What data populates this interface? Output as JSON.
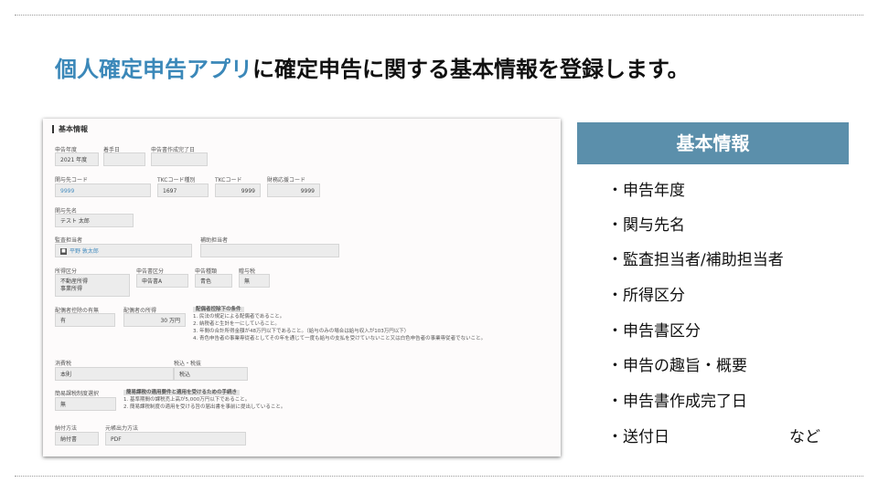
{
  "headline": {
    "accent": "個人確定申告アプリ",
    "rest": "に確定申告に関する基本情報を登録します。"
  },
  "shot": {
    "section_title": "基本情報",
    "fields": {
      "year_label": "申告年度",
      "year_value": "2021 年度",
      "start_label": "着手日",
      "start_value": "",
      "done_label": "申告書作成完了日",
      "done_value": "",
      "client_code_label": "関与先コード",
      "client_code_value": "9999",
      "tkc_type_label": "TKCコード種別",
      "tkc_type_value": "1697",
      "tkc_code_label": "TKCコード",
      "tkc_code_value": "9999",
      "fin_code_label": "財務応援コード",
      "fin_code_value": "9999",
      "client_name_label": "関与先名",
      "client_name_value": "テスト 太郎",
      "auditor_label": "監査担当者",
      "auditor_value": "平野 敦太郎",
      "assistant_label": "補助担当者",
      "assistant_value": "",
      "income_label": "所得区分",
      "income_value_1": "不動産所得",
      "income_value_2": "事業所得",
      "form_label": "申告書区分",
      "form_value": "申告書A",
      "kind_label": "申告種類",
      "kind_value": "青色",
      "tax_label": "贈与税",
      "tax_value": "無",
      "spouse_label": "配偶者控除の有無",
      "spouse_value": "有",
      "spouse_income_label": "配偶者の所得",
      "spouse_income_value": "30 万円",
      "consumption_label": "消費税",
      "consumption_value": "本則",
      "taxin_label": "税込・税抜",
      "taxin_value": "税込",
      "simple_label": "簡易課税制度選択",
      "simple_value": "無",
      "send_label": "納付方法",
      "send_value": "納付書",
      "output_label": "元帳出力方法",
      "output_value": "PDF"
    },
    "spouse_note": {
      "heading": "配偶者控除下の条件",
      "lines": [
        "1. 民法の規定による配偶者であること。",
        "2. 納税者と生計を一にしていること。",
        "3. 年間の合計所得金額が48万円以下であること。（給与のみの場合は給与収入が103万円以下）",
        "4. 青色申告者の事業専従者としてその年を通じて一度も給与の支払を受けていないこと又は白色申告者の事業専従者でないこと。"
      ]
    },
    "simple_note": {
      "heading": "簡易課税の適用要件と適用を受けるための手続き",
      "lines": [
        "1. 基準期間の課税売上高が5,000万円以下であること。",
        "2. 簡易課税制度の適用を受ける旨の届出書を事前に提出していること。"
      ]
    }
  },
  "panel": {
    "title": "基本情報",
    "items": [
      "・申告年度",
      "・関与先名",
      "・監査担当者/補助担当者",
      "・所得区分",
      "・申告書区分",
      "・申告の趣旨・概要",
      "・申告書作成完了日",
      "・送付日"
    ],
    "extra": "など"
  }
}
